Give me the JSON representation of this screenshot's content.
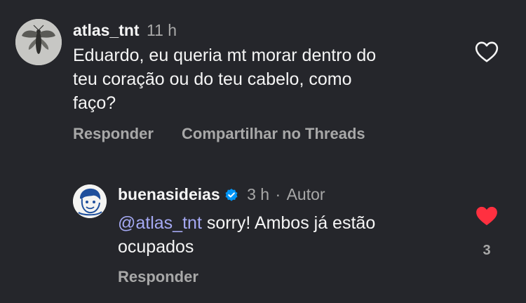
{
  "comment": {
    "username": "atlas_tnt",
    "time": "11 h",
    "text_line1": "Eduardo, eu queria mt morar dentro do",
    "text_line2": "teu coração ou do teu cabelo, como",
    "text_line3": "faço?",
    "reply_label": "Responder",
    "share_label": "Compartilhar no Threads",
    "avatar_icon": "moth-avatar",
    "like_icon": "heart-outline-icon"
  },
  "reply": {
    "username": "buenasideias",
    "verified_icon": "verified-badge-icon",
    "time": "3 h",
    "separator": "·",
    "author_label": "Autor",
    "mention": "@atlas_tnt",
    "text_after_mention": " sorry! Ambos já estão",
    "text_line2": "ocupados",
    "reply_label": "Responder",
    "like_icon": "heart-filled-icon",
    "like_count": "3"
  },
  "colors": {
    "background": "#25262b",
    "text": "#f5f5f5",
    "muted": "#a8a8a8",
    "mention": "#a5a9f3",
    "liked": "#ff3040",
    "verified": "#0095f6"
  }
}
